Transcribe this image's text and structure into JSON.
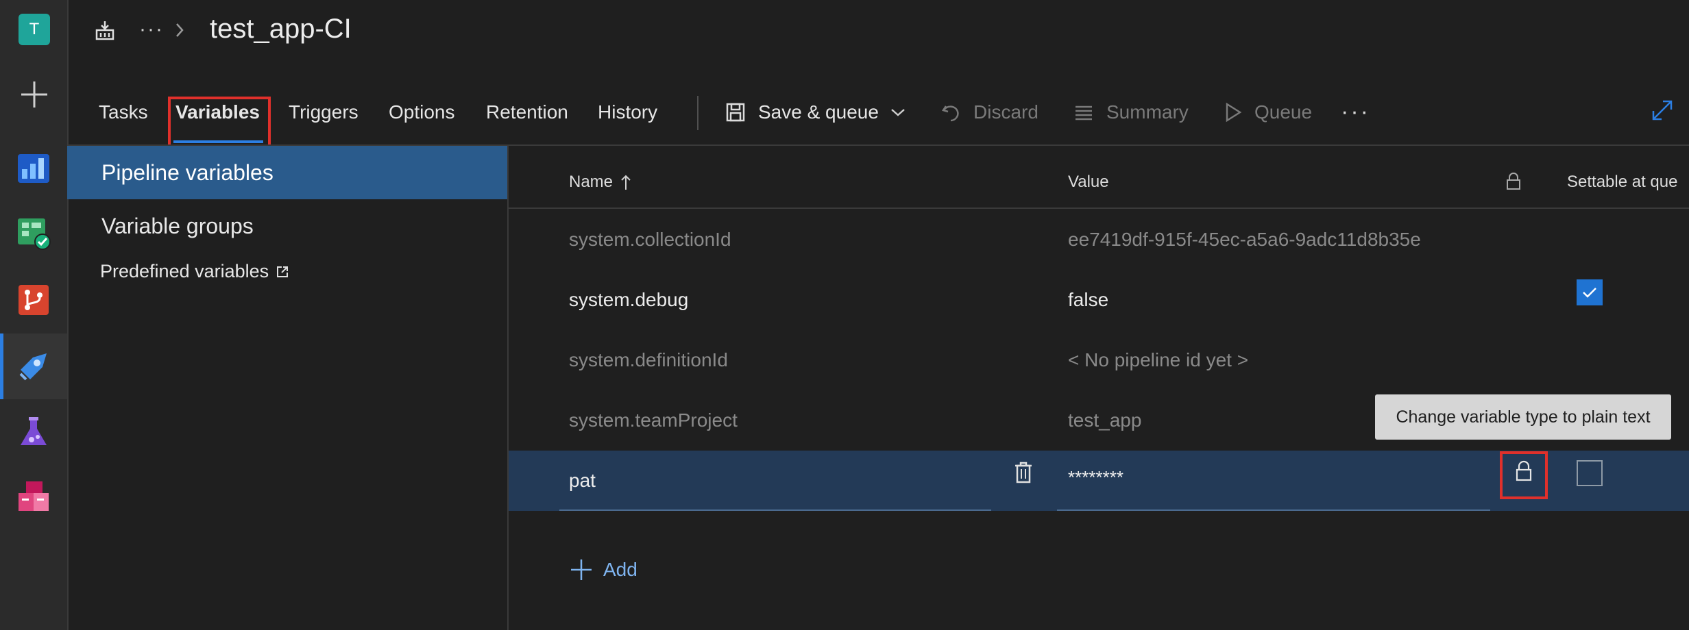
{
  "rail": {
    "avatar_letter": "T"
  },
  "header": {
    "more": "···",
    "title": "test_app-CI"
  },
  "tabs": [
    {
      "label": "Tasks"
    },
    {
      "label": "Variables"
    },
    {
      "label": "Triggers"
    },
    {
      "label": "Options"
    },
    {
      "label": "Retention"
    },
    {
      "label": "History"
    }
  ],
  "toolbar": {
    "save_queue": "Save & queue",
    "discard": "Discard",
    "summary": "Summary",
    "queue": "Queue",
    "more": "···"
  },
  "left_panel": {
    "pipeline_variables": "Pipeline variables",
    "variable_groups": "Variable groups",
    "predefined_variables": "Predefined variables"
  },
  "table": {
    "headers": {
      "name": "Name",
      "value": "Value",
      "settable": "Settable at que"
    },
    "rows": [
      {
        "name": "system.collectionId",
        "value": "ee7419df-915f-45ec-a5a6-9adc11d8b35e"
      },
      {
        "name": "system.debug",
        "value": "false"
      },
      {
        "name": "system.definitionId",
        "value": "< No pipeline id yet >"
      },
      {
        "name": "system.teamProject",
        "value": "test_app"
      },
      {
        "name": "pat",
        "value": "********"
      }
    ],
    "add_label": "Add"
  },
  "tooltip": "Change variable type to plain text",
  "colors": {
    "accent": "#2c7fe3",
    "highlight": "#e0302b",
    "selected_row": "#233a57"
  }
}
